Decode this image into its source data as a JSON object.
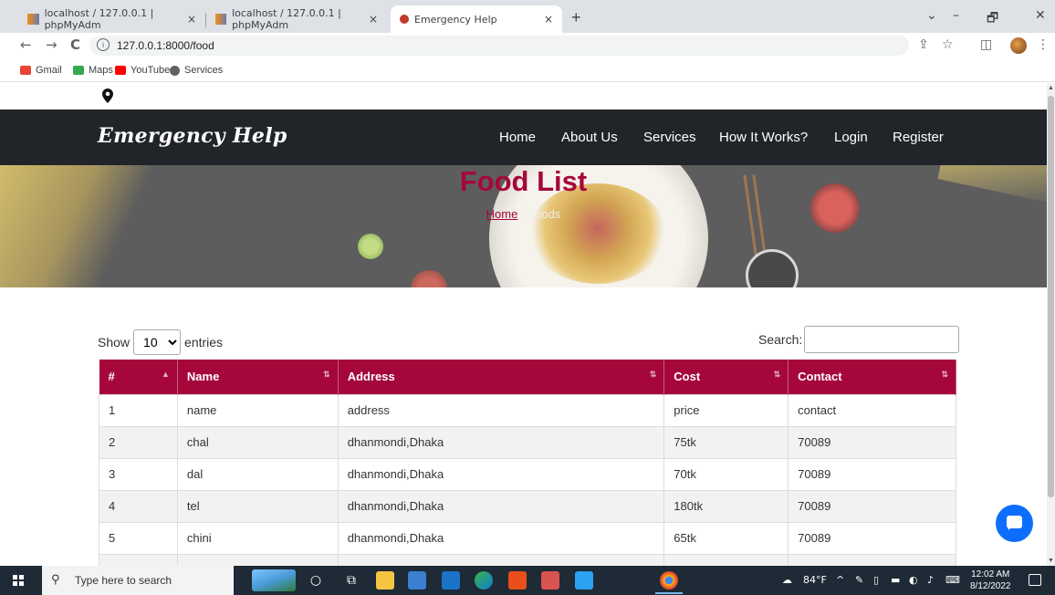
{
  "browser": {
    "tabs": [
      {
        "title": "localhost / 127.0.0.1 | phpMyAdm"
      },
      {
        "title": "localhost / 127.0.0.1 | phpMyAdm"
      },
      {
        "title": "Emergency Help"
      }
    ],
    "tab_close": "×",
    "new_tab": "+",
    "window": {
      "minimize": "–",
      "maximize": "🗗",
      "close": "✕",
      "chevron": "⌄"
    },
    "nav": {
      "back": "←",
      "forward": "→",
      "reload": "C"
    },
    "url": "127.0.0.1:8000/food",
    "bookmarks": [
      {
        "label": "Gmail",
        "color": "#ea4335"
      },
      {
        "label": "Maps",
        "color": "#34a853"
      },
      {
        "label": "YouTube",
        "color": "#ff0000"
      },
      {
        "label": "Services",
        "color": "#5f6368"
      }
    ]
  },
  "site": {
    "brand": "Emergency Help",
    "nav": [
      "Home",
      "About Us",
      "Services",
      "How It Works?",
      "Login",
      "Register"
    ],
    "hero": {
      "title": "Food List",
      "breadcrumb_home": "Home",
      "breadcrumb_sep": "/",
      "breadcrumb_current": "Foods"
    },
    "accent_color": "#a5073b",
    "navbar_color": "#212529"
  },
  "datatable": {
    "show_label": "Show",
    "entries_value": "10",
    "entries_label": "entries",
    "search_label": "Search:",
    "search_value": "",
    "columns": [
      "#",
      "Name",
      "Address",
      "Cost",
      "Contact"
    ],
    "rows": [
      [
        "1",
        "name",
        "address",
        "price",
        "contact"
      ],
      [
        "2",
        "chal",
        "dhanmondi,Dhaka",
        "75tk",
        "70089"
      ],
      [
        "3",
        "dal",
        "dhanmondi,Dhaka",
        "70tk",
        "70089"
      ],
      [
        "4",
        "tel",
        "dhanmondi,Dhaka",
        "180tk",
        "70089"
      ],
      [
        "5",
        "chini",
        "dhanmondi,Dhaka",
        "65tk",
        "70089"
      ]
    ]
  },
  "taskbar": {
    "search_placeholder": "Type here to search",
    "weather": "84°F",
    "time": "12:02 AM",
    "date": "8/12/2022"
  }
}
